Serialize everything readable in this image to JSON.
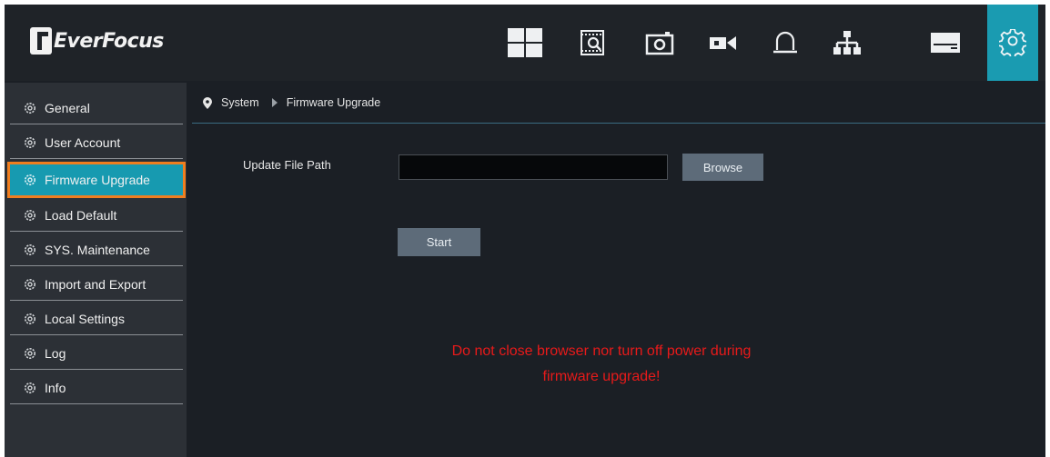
{
  "app": {
    "brand": "EverFocus",
    "accent_color": "#1a9bb1",
    "highlight_color": "#f07e1f"
  },
  "topnav": [
    {
      "name": "live-view",
      "icon": "grid-layout-icon"
    },
    {
      "name": "playback",
      "icon": "film-search-icon"
    },
    {
      "name": "snapshot",
      "icon": "camera-icon"
    },
    {
      "name": "camera",
      "icon": "video-camera-icon"
    },
    {
      "name": "alarm",
      "icon": "alarm-bell-icon"
    },
    {
      "name": "network",
      "icon": "network-icon"
    },
    {
      "name": "storage",
      "icon": "hard-drive-icon"
    },
    {
      "name": "system",
      "icon": "gear-icon",
      "active": true
    }
  ],
  "sidebar": {
    "items": [
      {
        "label": "General"
      },
      {
        "label": "User Account"
      },
      {
        "label": "Firmware Upgrade",
        "active": true
      },
      {
        "label": "Load Default"
      },
      {
        "label": "SYS. Maintenance"
      },
      {
        "label": "Import and Export"
      },
      {
        "label": "Local Settings"
      },
      {
        "label": "Log"
      },
      {
        "label": "Info"
      }
    ]
  },
  "breadcrumb": {
    "root": "System",
    "current": "Firmware Upgrade"
  },
  "form": {
    "file_path_label": "Update File Path",
    "file_path_value": "",
    "browse_label": "Browse",
    "start_label": "Start"
  },
  "warning": {
    "line1": "Do not close browser nor turn off power during",
    "line2": "firmware upgrade!",
    "color": "#e81a1a"
  }
}
